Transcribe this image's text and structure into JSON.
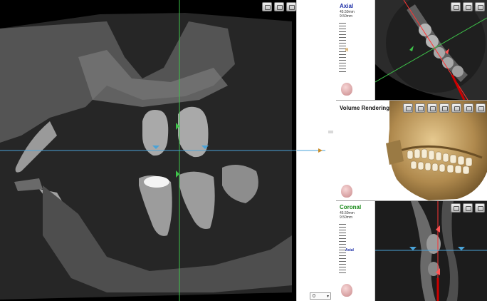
{
  "main_view": {
    "toolbar_icons": [
      "toolbar-button-1",
      "toolbar-button-2",
      "toolbar-button-3",
      "toolbar-button-4",
      "toolbar-button-5"
    ]
  },
  "slider": {
    "select_value": "0"
  },
  "axial": {
    "title": "Axial",
    "info_line1": "45.50mm",
    "info_line2": "9.50mm",
    "marker": "R",
    "title_color": "#1c2ea6"
  },
  "volume_rendering": {
    "title": "Volume Rendering"
  },
  "coronal": {
    "title": "Coronal",
    "info_line1": "45.50mm",
    "info_line2": "9.50mm",
    "axial_marker": "Axial",
    "title_color": "#1a8a1a"
  },
  "colors": {
    "crosshair_green": "#3ec44a",
    "crosshair_blue": "#4aa3d8",
    "marker_red": "#ff5555"
  }
}
